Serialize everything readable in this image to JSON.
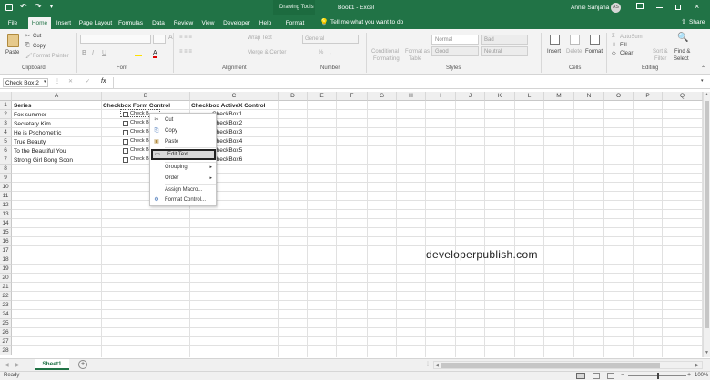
{
  "title_bar": {
    "save_icon": "save-icon",
    "context_tab": "Drawing Tools",
    "document_title": "Book1 - Excel",
    "user_name": "Annie Sanjana",
    "user_initials": "AS"
  },
  "tabs": [
    "File",
    "Home",
    "Insert",
    "Page Layout",
    "Formulas",
    "Data",
    "Review",
    "View",
    "Developer",
    "Help",
    "Format"
  ],
  "active_tab": "Home",
  "tell_me": "Tell me what you want to do",
  "share_label": "Share",
  "ribbon": {
    "clipboard": {
      "paste": "Paste",
      "cut": "Cut",
      "copy": "Copy",
      "format_painter": "Format Painter",
      "group": "Clipboard"
    },
    "font": {
      "group": "Font",
      "bold": "B",
      "italic": "I",
      "underline": "U"
    },
    "alignment": {
      "wrap_text": "Wrap Text",
      "merge_center": "Merge & Center",
      "group": "Alignment"
    },
    "number": {
      "format": "General",
      "percent": "%",
      "comma": ",",
      "group": "Number"
    },
    "styles": {
      "conditional": "Conditional",
      "conditional2": "Formatting",
      "format_as": "Format as",
      "table": "Table",
      "normal": "Normal",
      "bad": "Bad",
      "good": "Good",
      "neutral": "Neutral",
      "group": "Styles"
    },
    "cells": {
      "insert": "Insert",
      "delete": "Delete",
      "format": "Format",
      "group": "Cells"
    },
    "editing": {
      "autosum": "AutoSum",
      "fill": "Fill",
      "clear": "Clear",
      "sort_filter": "Sort &",
      "sort_filter2": "Filter",
      "find_select": "Find &",
      "find_select2": "Select",
      "group": "Editing"
    }
  },
  "formula_bar": {
    "name_box": "Check Box 2",
    "fx": "fx",
    "value": ""
  },
  "columns": [
    "A",
    "B",
    "C",
    "D",
    "E",
    "F",
    "G",
    "H",
    "I",
    "J",
    "K",
    "L",
    "M",
    "N",
    "O",
    "P",
    "Q"
  ],
  "rows": [
    "1",
    "2",
    "3",
    "4",
    "5",
    "6",
    "7",
    "8",
    "9",
    "10",
    "11",
    "12",
    "13",
    "14",
    "15",
    "16",
    "17",
    "18",
    "19",
    "20",
    "21",
    "22",
    "23",
    "24",
    "25",
    "26",
    "27",
    "28"
  ],
  "cells": {
    "a1": "Series",
    "b1": "Checkbox Form Control",
    "c1": "Checkbox ActiveX Control",
    "a2": "Fox summer",
    "a3": "Secretary Kim",
    "a4": "He is Pschometric",
    "a5": "True Beauty",
    "a6": "To the Beautiful You",
    "a7": "Strong Girl Bong Soon"
  },
  "form_checkboxes": [
    "Check Bo",
    "Check Bo",
    "Check Bo",
    "Check Bo",
    "Check Bo",
    "Check Bo"
  ],
  "activex_checkboxes": [
    "CheckBox1",
    "CheckBox2",
    "CheckBox3",
    "CheckBox4",
    "CheckBox5",
    "CheckBox6"
  ],
  "watermark": "developerpublish.com",
  "context_menu": {
    "cut": "Cut",
    "copy": "Copy",
    "paste": "Paste",
    "edit_text": "Edit Text",
    "grouping": "Grouping",
    "order": "Order",
    "assign_macro": "Assign Macro...",
    "format_control": "Format Control..."
  },
  "sheet_tab": "Sheet1",
  "status": {
    "ready": "Ready",
    "zoom": "100%"
  }
}
